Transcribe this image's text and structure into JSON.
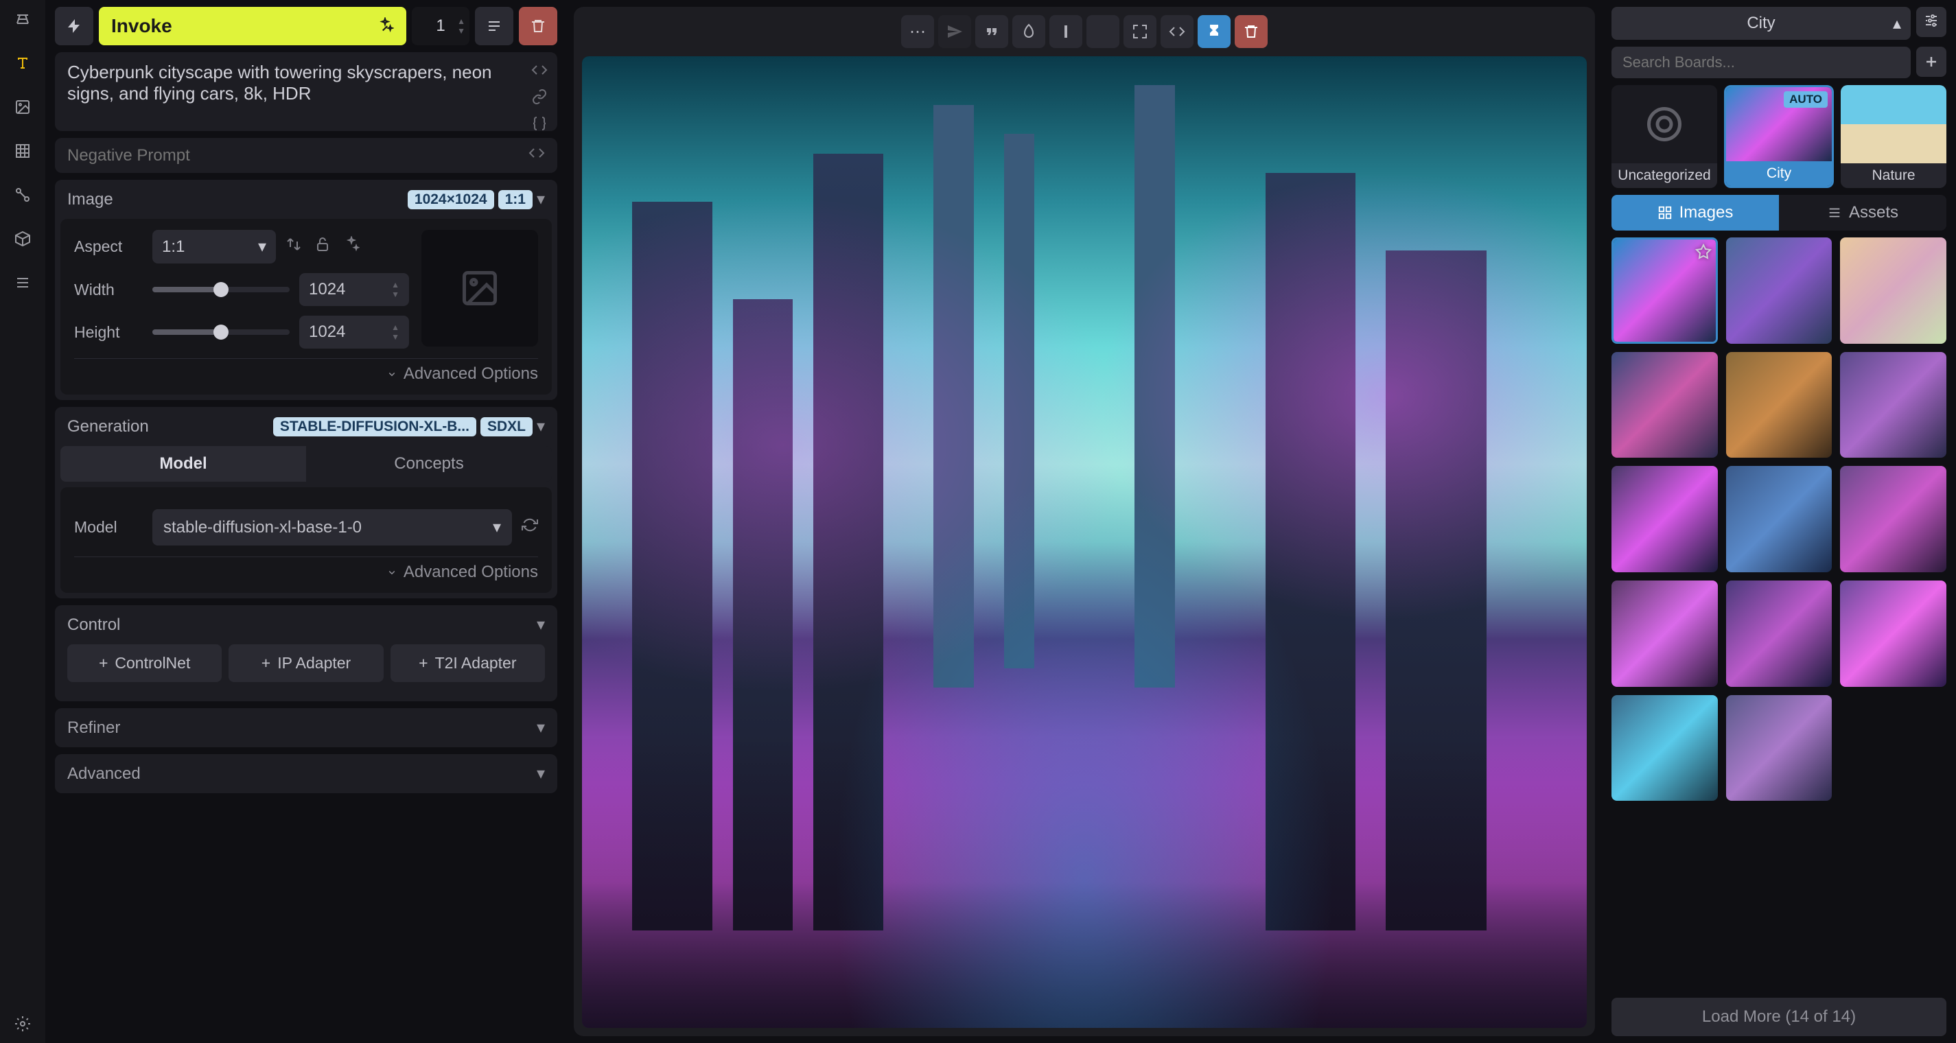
{
  "app": {
    "name": "Invoke"
  },
  "toolbar": {
    "invoke_label": "Invoke",
    "iterations": "1"
  },
  "prompt": {
    "positive": "Cyberpunk cityscape with towering skyscrapers, neon signs, and flying cars, 8k, HDR",
    "negative_placeholder": "Negative Prompt"
  },
  "image": {
    "title": "Image",
    "resolution_badge": "1024×1024",
    "ratio_badge": "1:1",
    "aspect_label": "Aspect",
    "aspect_value": "1:1",
    "width_label": "Width",
    "width_value": "1024",
    "height_label": "Height",
    "height_value": "1024",
    "advanced": "Advanced Options"
  },
  "generation": {
    "title": "Generation",
    "model_badge": "STABLE-DIFFUSION-XL-B...",
    "type_badge": "SDXL",
    "tab_model": "Model",
    "tab_concepts": "Concepts",
    "model_label": "Model",
    "model_value": "stable-diffusion-xl-base-1-0",
    "advanced": "Advanced Options"
  },
  "control": {
    "title": "Control",
    "controlnet": "ControlNet",
    "ip_adapter": "IP Adapter",
    "t2i_adapter": "T2I Adapter"
  },
  "refiner": {
    "title": "Refiner"
  },
  "advanced": {
    "title": "Advanced"
  },
  "boards": {
    "current": "City",
    "search_placeholder": "Search Boards...",
    "items": [
      {
        "label": "Uncategorized"
      },
      {
        "label": "City",
        "auto": "AUTO"
      },
      {
        "label": "Nature"
      }
    ]
  },
  "gallery_tabs": {
    "images": "Images",
    "assets": "Assets"
  },
  "load_more": "Load More (14 of 14)",
  "gallery": {
    "count": 14
  }
}
